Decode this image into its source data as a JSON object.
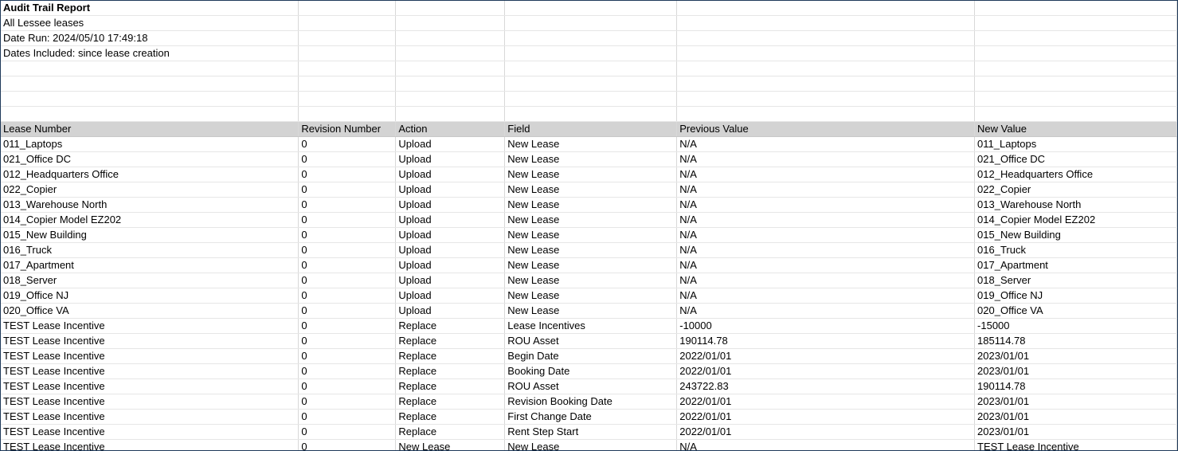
{
  "report": {
    "title": "Audit Trail Report",
    "scope": "All Lessee leases",
    "date_run": "Date Run: 2024/05/10 17:49:18",
    "dates_included": "Dates Included: since lease creation"
  },
  "columns": [
    "Lease Number",
    "Revision Number",
    "Action",
    "Field",
    "Previous Value",
    "New Value"
  ],
  "rows": [
    [
      "011_Laptops",
      "0",
      "Upload",
      "New Lease",
      "N/A",
      "011_Laptops"
    ],
    [
      "021_Office DC",
      "0",
      "Upload",
      "New Lease",
      "N/A",
      "021_Office DC"
    ],
    [
      "012_Headquarters Office",
      "0",
      "Upload",
      "New Lease",
      "N/A",
      "012_Headquarters Office"
    ],
    [
      "022_Copier",
      "0",
      "Upload",
      "New Lease",
      "N/A",
      "022_Copier"
    ],
    [
      "013_Warehouse North",
      "0",
      "Upload",
      "New Lease",
      "N/A",
      "013_Warehouse North"
    ],
    [
      "014_Copier Model EZ202",
      "0",
      "Upload",
      "New Lease",
      "N/A",
      "014_Copier Model EZ202"
    ],
    [
      "015_New Building",
      "0",
      "Upload",
      "New Lease",
      "N/A",
      "015_New Building"
    ],
    [
      "016_Truck",
      "0",
      "Upload",
      "New Lease",
      "N/A",
      "016_Truck"
    ],
    [
      "017_Apartment",
      "0",
      "Upload",
      "New Lease",
      "N/A",
      "017_Apartment"
    ],
    [
      "018_Server",
      "0",
      "Upload",
      "New Lease",
      "N/A",
      "018_Server"
    ],
    [
      "019_Office NJ",
      "0",
      "Upload",
      "New Lease",
      "N/A",
      "019_Office NJ"
    ],
    [
      "020_Office VA",
      "0",
      "Upload",
      "New Lease",
      "N/A",
      "020_Office VA"
    ],
    [
      "TEST Lease Incentive",
      "0",
      "Replace",
      "Lease Incentives",
      "-10000",
      "-15000"
    ],
    [
      "TEST Lease Incentive",
      "0",
      "Replace",
      "ROU Asset",
      "190114.78",
      "185114.78"
    ],
    [
      "TEST Lease Incentive",
      "0",
      "Replace",
      "Begin Date",
      "2022/01/01",
      "2023/01/01"
    ],
    [
      "TEST Lease Incentive",
      "0",
      "Replace",
      "Booking Date",
      "2022/01/01",
      "2023/01/01"
    ],
    [
      "TEST Lease Incentive",
      "0",
      "Replace",
      "ROU Asset",
      "243722.83",
      "190114.78"
    ],
    [
      "TEST Lease Incentive",
      "0",
      "Replace",
      "Revision Booking Date",
      "2022/01/01",
      "2023/01/01"
    ],
    [
      "TEST Lease Incentive",
      "0",
      "Replace",
      "First Change Date",
      "2022/01/01",
      "2023/01/01"
    ],
    [
      "TEST Lease Incentive",
      "0",
      "Replace",
      "Rent Step Start",
      "2022/01/01",
      "2023/01/01"
    ],
    [
      "TEST Lease Incentive",
      "0",
      "New Lease",
      "New Lease",
      "N/A",
      "TEST Lease Incentive"
    ]
  ]
}
